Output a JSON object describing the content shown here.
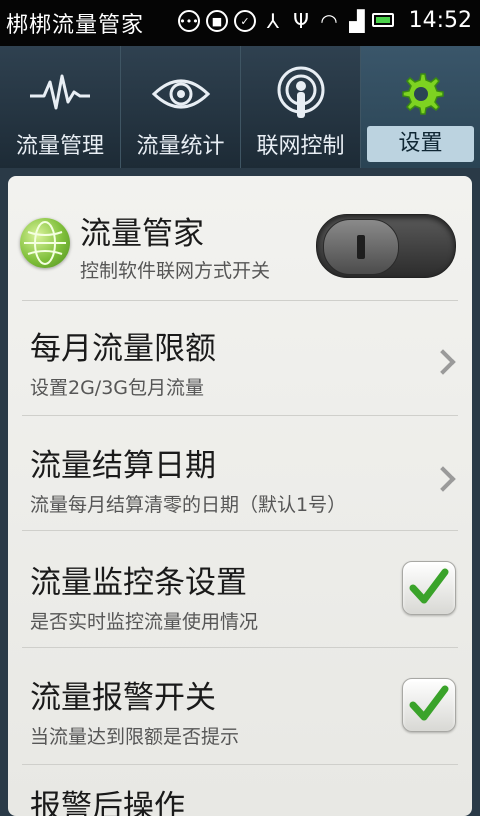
{
  "status_bar": {
    "app_title": "梆梆流量管家",
    "time": "14:52"
  },
  "tabs": [
    {
      "label": "流量管理",
      "icon": "pulse-icon",
      "active": false
    },
    {
      "label": "流量统计",
      "icon": "eye-icon",
      "active": false
    },
    {
      "label": "联网控制",
      "icon": "broadcast-icon",
      "active": false
    },
    {
      "label": "设置",
      "icon": "gear-icon",
      "active": true
    }
  ],
  "settings": {
    "master": {
      "title": "流量管家",
      "subtitle": "控制软件联网方式开关",
      "toggle_on": false
    },
    "monthly_limit": {
      "title": "每月流量限额",
      "subtitle": "设置2G/3G包月流量"
    },
    "billing_date": {
      "title": "流量结算日期",
      "subtitle": "流量每月结算清零的日期（默认1号）"
    },
    "monitor_bar": {
      "title": "流量监控条设置",
      "subtitle": "是否实时监控流量使用情况",
      "checked": true
    },
    "alert_switch": {
      "title": "流量报警开关",
      "subtitle": "当流量达到限额是否提示",
      "checked": true
    },
    "after_alert": {
      "title": "报警后操作"
    }
  },
  "colors": {
    "accent_green": "#3aa32a",
    "tab_active": "#bcd3e0"
  }
}
